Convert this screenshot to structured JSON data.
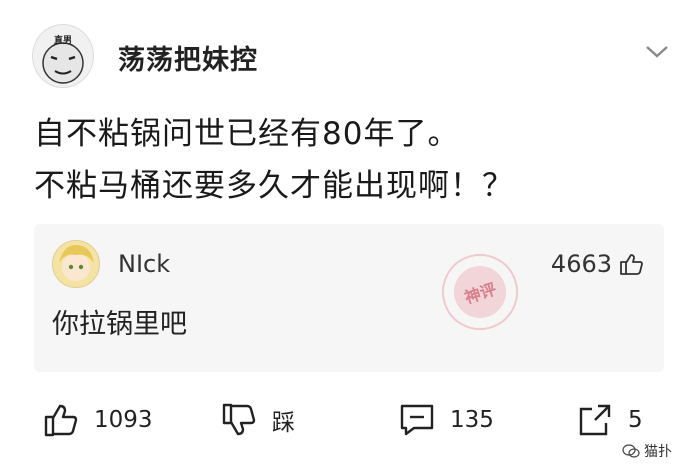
{
  "post": {
    "author": "荡荡把妹控",
    "avatar_tag": "直男",
    "lines": [
      "自不粘锅问世已经有80年了。",
      "不粘马桶还要多久才能出现啊！？"
    ]
  },
  "comment": {
    "username": "NIck",
    "likes": "4663",
    "text": "你拉锅里吧",
    "stamp_text": "神评"
  },
  "actions": {
    "like_count": "1093",
    "dislike_label": "踩",
    "comment_count": "135",
    "share_count": "5"
  },
  "watermark": "猫扑",
  "icons": {
    "chevron": "chevron-down-icon",
    "like": "thumbs-up-icon",
    "dislike": "thumbs-down-icon",
    "comment": "comment-icon",
    "share": "share-icon"
  },
  "colors": {
    "background": "#ffffff",
    "card": "#f6f6f6",
    "stamp": "#dc5a6e"
  }
}
